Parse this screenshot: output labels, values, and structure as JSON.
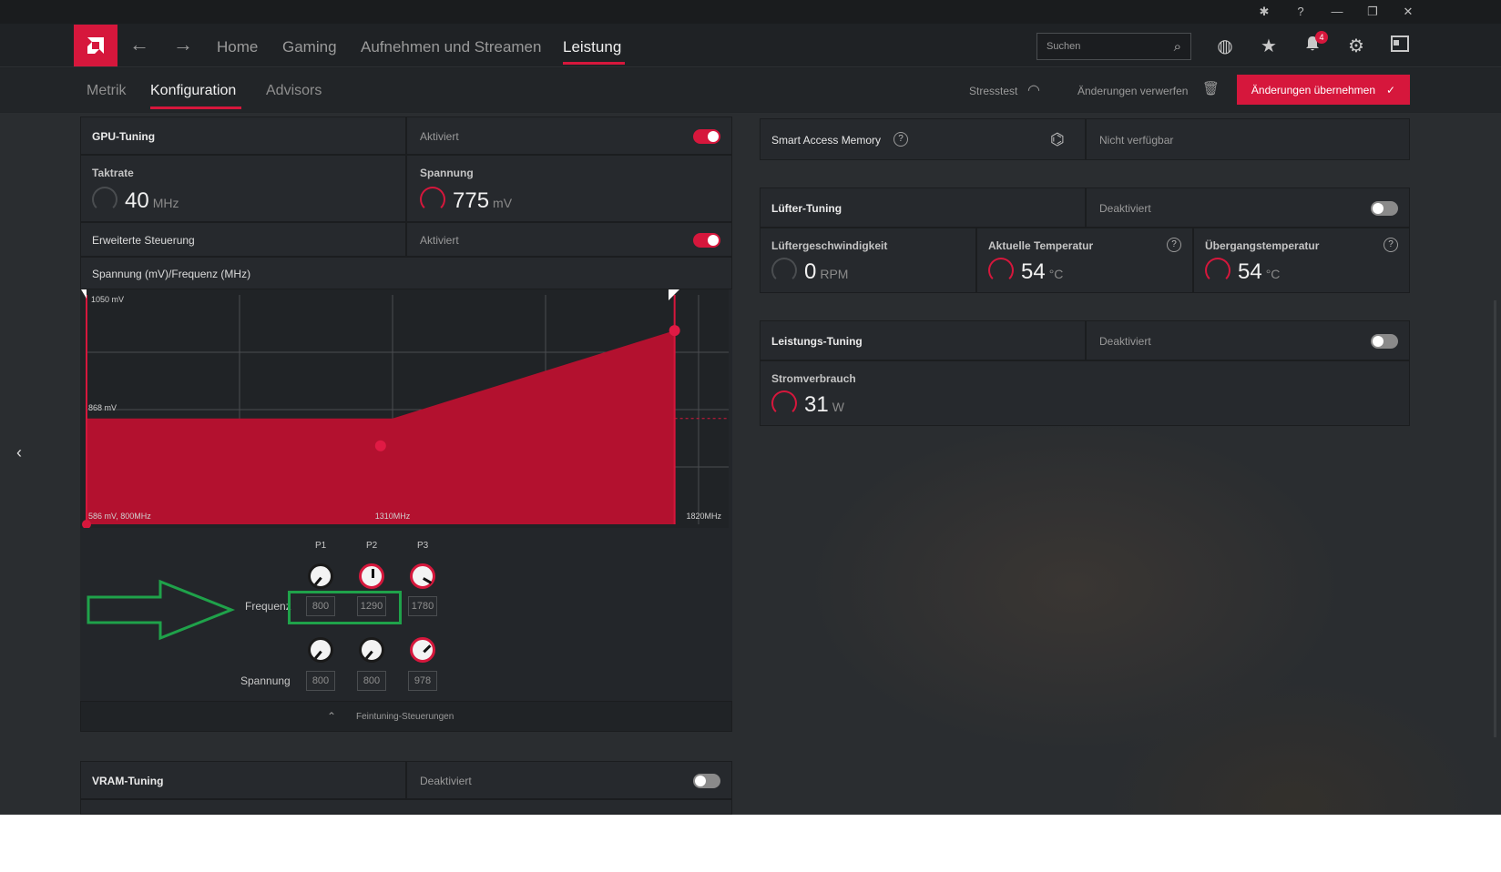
{
  "window": {
    "minimize": "—",
    "restore": "❐",
    "close": "✕"
  },
  "nav": {
    "items": [
      "Home",
      "Gaming",
      "Aufnehmen und Streamen",
      "Leistung"
    ],
    "search_placeholder": "Suchen",
    "notification_count": "4"
  },
  "subnav": {
    "tabs": [
      "Metrik",
      "Konfiguration",
      "Advisors"
    ],
    "stresstest": "Stresstest",
    "discard": "Änderungen verwerfen",
    "apply": "Änderungen übernehmen"
  },
  "gpu": {
    "title": "GPU-Tuning",
    "state": "Aktiviert",
    "clock_label": "Taktrate",
    "clock_value": "40",
    "clock_unit": "MHz",
    "voltage_label": "Spannung",
    "voltage_value": "775",
    "voltage_unit": "mV",
    "adv_label": "Erweiterte Steuerung",
    "adv_state": "Aktiviert",
    "curve_label": "Spannung (mV)/Frequenz (MHz)"
  },
  "chart_data": {
    "type": "area",
    "x_unit": "MHz",
    "y_unit": "mV",
    "x": [
      800,
      1310,
      1820
    ],
    "points": [
      [
        800,
        586
      ],
      [
        1290,
        800
      ],
      [
        1780,
        978
      ]
    ],
    "tick_labels": {
      "top": "1050 mV",
      "mid": "868 mV",
      "origin": "586 mV, 800MHz",
      "xmid": "1310MHz",
      "xmax": "1820MHz"
    },
    "xlim": [
      800,
      1820
    ],
    "ylim": [
      586,
      1050
    ],
    "grid": true
  },
  "tuning": {
    "p_labels": [
      "P1",
      "P2",
      "P3"
    ],
    "freq_label": "Frequenz",
    "freq_values": [
      "800",
      "1290",
      "1780"
    ],
    "volt_label": "Spannung",
    "volt_values": [
      "800",
      "800",
      "978"
    ],
    "fine_label": "Feintuning-Steuerungen"
  },
  "vram": {
    "title": "VRAM-Tuning",
    "state": "Deaktiviert"
  },
  "sam": {
    "title": "Smart Access Memory",
    "state": "Nicht verfügbar"
  },
  "fan": {
    "title": "Lüfter-Tuning",
    "state": "Deaktiviert",
    "speed_label": "Lüftergeschwindigkeit",
    "speed_value": "0",
    "speed_unit": "RPM",
    "temp_label": "Aktuelle Temperatur",
    "temp_value": "54",
    "temp_unit": "°C",
    "junction_label": "Übergangstemperatur",
    "junction_value": "54",
    "junction_unit": "°C"
  },
  "power": {
    "title": "Leistungs-Tuning",
    "state": "Deaktiviert",
    "draw_label": "Stromverbrauch",
    "draw_value": "31",
    "draw_unit": "W"
  },
  "colors": {
    "accent": "#d6173c",
    "highlight": "#1fa24a"
  }
}
